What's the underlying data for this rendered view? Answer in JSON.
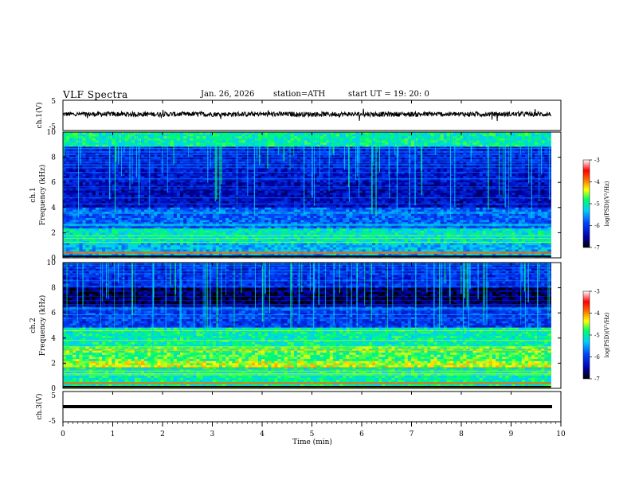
{
  "header": {
    "title": "VLF  Spectra",
    "date": "Jan. 26, 2026",
    "station": "station=ATH",
    "start": "start  UT  =   19: 20: 0"
  },
  "chart_data": [
    {
      "type": "line",
      "name": "ch1-waveform",
      "ylabel": "ch.1(V)",
      "ylim": [
        -5,
        5
      ],
      "yticks": [
        "5",
        "-5"
      ],
      "xlim": [
        0,
        10
      ],
      "description_level": 0.4
    },
    {
      "type": "heatmap",
      "name": "ch1-spectrogram",
      "ylabel": "ch.1\nFrequency (kHz)",
      "ylabel_line1": "ch.1",
      "ylabel_line2": "Frequency (kHz)",
      "ylim": [
        0,
        10
      ],
      "yticks": [
        "0",
        "2",
        "4",
        "6",
        "8",
        "10"
      ],
      "xlim": [
        0,
        9.8
      ],
      "colorbar": {
        "label": "log(PSD)(V²/Hz)",
        "range": [
          -7,
          -3
        ],
        "ticks": [
          "-3",
          "-4",
          "-5",
          "-6",
          "-7"
        ]
      }
    },
    {
      "type": "heatmap",
      "name": "ch2-spectrogram",
      "ylabel_line1": "ch.2",
      "ylabel_line2": "Frequency (kHz)",
      "ylim": [
        0,
        10
      ],
      "yticks": [
        "0",
        "2",
        "4",
        "6",
        "8",
        "10"
      ],
      "xlim": [
        0,
        9.8
      ],
      "colorbar": {
        "label": "log(PSD)(V²/Hz)",
        "range": [
          -7,
          -3
        ],
        "ticks": [
          "-3",
          "-4",
          "-5",
          "-6",
          "-7"
        ]
      }
    },
    {
      "type": "line",
      "name": "ch3-waveform",
      "ylabel": "ch.3(V)",
      "ylim": [
        -5,
        5
      ],
      "yticks": [
        "5",
        "-5"
      ],
      "xlim": [
        0,
        10
      ],
      "level": -1.5
    }
  ],
  "xaxis": {
    "label": "Time  (min)",
    "ticks": [
      "0",
      "1",
      "2",
      "3",
      "4",
      "5",
      "6",
      "7",
      "8",
      "9",
      "10"
    ],
    "range": [
      0,
      10
    ]
  },
  "colors": {
    "colormap": [
      "#000000",
      "#0000ff",
      "#00aaff",
      "#00ff66",
      "#ffff00",
      "#ff0000",
      "#ffffff"
    ]
  }
}
